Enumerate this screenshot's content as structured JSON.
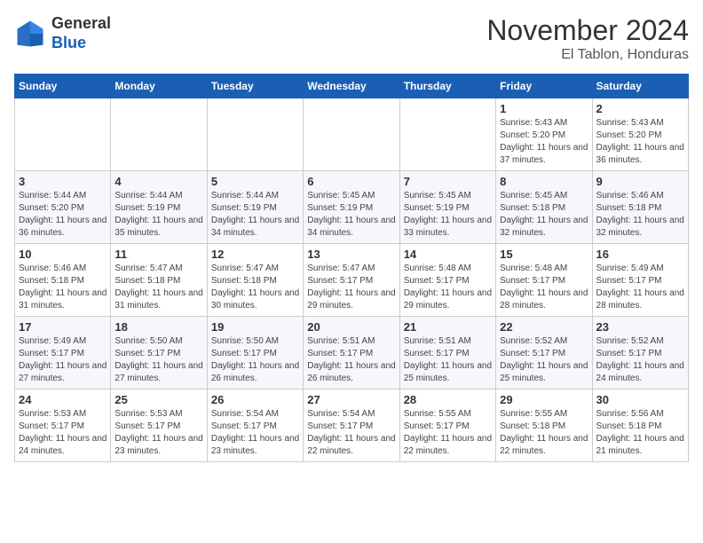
{
  "logo": {
    "general": "General",
    "blue": "Blue"
  },
  "header": {
    "month": "November 2024",
    "location": "El Tablon, Honduras"
  },
  "weekdays": [
    "Sunday",
    "Monday",
    "Tuesday",
    "Wednesday",
    "Thursday",
    "Friday",
    "Saturday"
  ],
  "weeks": [
    [
      {
        "day": "",
        "info": ""
      },
      {
        "day": "",
        "info": ""
      },
      {
        "day": "",
        "info": ""
      },
      {
        "day": "",
        "info": ""
      },
      {
        "day": "",
        "info": ""
      },
      {
        "day": "1",
        "info": "Sunrise: 5:43 AM\nSunset: 5:20 PM\nDaylight: 11 hours and 37 minutes."
      },
      {
        "day": "2",
        "info": "Sunrise: 5:43 AM\nSunset: 5:20 PM\nDaylight: 11 hours and 36 minutes."
      }
    ],
    [
      {
        "day": "3",
        "info": "Sunrise: 5:44 AM\nSunset: 5:20 PM\nDaylight: 11 hours and 36 minutes."
      },
      {
        "day": "4",
        "info": "Sunrise: 5:44 AM\nSunset: 5:19 PM\nDaylight: 11 hours and 35 minutes."
      },
      {
        "day": "5",
        "info": "Sunrise: 5:44 AM\nSunset: 5:19 PM\nDaylight: 11 hours and 34 minutes."
      },
      {
        "day": "6",
        "info": "Sunrise: 5:45 AM\nSunset: 5:19 PM\nDaylight: 11 hours and 34 minutes."
      },
      {
        "day": "7",
        "info": "Sunrise: 5:45 AM\nSunset: 5:19 PM\nDaylight: 11 hours and 33 minutes."
      },
      {
        "day": "8",
        "info": "Sunrise: 5:45 AM\nSunset: 5:18 PM\nDaylight: 11 hours and 32 minutes."
      },
      {
        "day": "9",
        "info": "Sunrise: 5:46 AM\nSunset: 5:18 PM\nDaylight: 11 hours and 32 minutes."
      }
    ],
    [
      {
        "day": "10",
        "info": "Sunrise: 5:46 AM\nSunset: 5:18 PM\nDaylight: 11 hours and 31 minutes."
      },
      {
        "day": "11",
        "info": "Sunrise: 5:47 AM\nSunset: 5:18 PM\nDaylight: 11 hours and 31 minutes."
      },
      {
        "day": "12",
        "info": "Sunrise: 5:47 AM\nSunset: 5:18 PM\nDaylight: 11 hours and 30 minutes."
      },
      {
        "day": "13",
        "info": "Sunrise: 5:47 AM\nSunset: 5:17 PM\nDaylight: 11 hours and 29 minutes."
      },
      {
        "day": "14",
        "info": "Sunrise: 5:48 AM\nSunset: 5:17 PM\nDaylight: 11 hours and 29 minutes."
      },
      {
        "day": "15",
        "info": "Sunrise: 5:48 AM\nSunset: 5:17 PM\nDaylight: 11 hours and 28 minutes."
      },
      {
        "day": "16",
        "info": "Sunrise: 5:49 AM\nSunset: 5:17 PM\nDaylight: 11 hours and 28 minutes."
      }
    ],
    [
      {
        "day": "17",
        "info": "Sunrise: 5:49 AM\nSunset: 5:17 PM\nDaylight: 11 hours and 27 minutes."
      },
      {
        "day": "18",
        "info": "Sunrise: 5:50 AM\nSunset: 5:17 PM\nDaylight: 11 hours and 27 minutes."
      },
      {
        "day": "19",
        "info": "Sunrise: 5:50 AM\nSunset: 5:17 PM\nDaylight: 11 hours and 26 minutes."
      },
      {
        "day": "20",
        "info": "Sunrise: 5:51 AM\nSunset: 5:17 PM\nDaylight: 11 hours and 26 minutes."
      },
      {
        "day": "21",
        "info": "Sunrise: 5:51 AM\nSunset: 5:17 PM\nDaylight: 11 hours and 25 minutes."
      },
      {
        "day": "22",
        "info": "Sunrise: 5:52 AM\nSunset: 5:17 PM\nDaylight: 11 hours and 25 minutes."
      },
      {
        "day": "23",
        "info": "Sunrise: 5:52 AM\nSunset: 5:17 PM\nDaylight: 11 hours and 24 minutes."
      }
    ],
    [
      {
        "day": "24",
        "info": "Sunrise: 5:53 AM\nSunset: 5:17 PM\nDaylight: 11 hours and 24 minutes."
      },
      {
        "day": "25",
        "info": "Sunrise: 5:53 AM\nSunset: 5:17 PM\nDaylight: 11 hours and 23 minutes."
      },
      {
        "day": "26",
        "info": "Sunrise: 5:54 AM\nSunset: 5:17 PM\nDaylight: 11 hours and 23 minutes."
      },
      {
        "day": "27",
        "info": "Sunrise: 5:54 AM\nSunset: 5:17 PM\nDaylight: 11 hours and 22 minutes."
      },
      {
        "day": "28",
        "info": "Sunrise: 5:55 AM\nSunset: 5:17 PM\nDaylight: 11 hours and 22 minutes."
      },
      {
        "day": "29",
        "info": "Sunrise: 5:55 AM\nSunset: 5:18 PM\nDaylight: 11 hours and 22 minutes."
      },
      {
        "day": "30",
        "info": "Sunrise: 5:56 AM\nSunset: 5:18 PM\nDaylight: 11 hours and 21 minutes."
      }
    ]
  ]
}
